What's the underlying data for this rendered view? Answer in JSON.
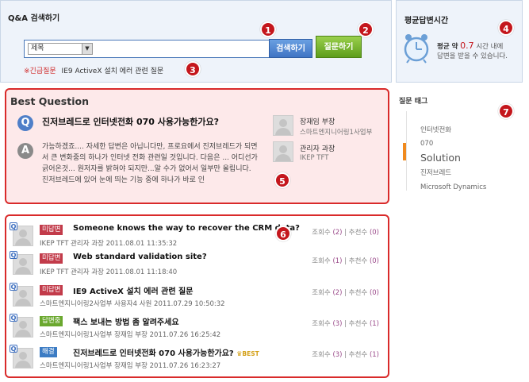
{
  "search": {
    "title": "Q&A 검색하기",
    "category": "제목",
    "search_btn": "검색하기",
    "ask_btn": "질문하기",
    "urgent_label": "긴급질문",
    "urgent_text": "IE9 ActiveX 설치 에러 관련 질문"
  },
  "avg": {
    "title": "평균답변시간",
    "prefix": "평균 약",
    "value": "0.7",
    "suffix": "시간 내에",
    "line2": "답변을 받을 수 있습니다."
  },
  "best": {
    "title": "Best Question",
    "question": "진저브레드로 인터넷전화 070 사용가능한가요?",
    "answer": "가능하겠죠.... 자세한 답변은 아닙니다만, 프로요에서 진저브레드가 되면서 큰 변화중의 하나가 인터넷 전화 관련일 것입니다. 다음은 ... 어디선가 긁어온것... 원저자를 밝혀야 되지만...알 수가 없어서 일부만 올립니다. 진저브레드에 있어 눈에 띄는 기능 중에 하나가 바로 인",
    "asker_name": "장재임 부장",
    "asker_org": "스마트엔지니어링1사업부",
    "answerer_name": "관리자 과장",
    "answerer_org": "IKEP TFT"
  },
  "tags": {
    "title": "질문 태그",
    "items": [
      "인터넷전화",
      "070",
      "Solution",
      "진저브레드",
      "Microsoft Dynamics"
    ]
  },
  "badges": [
    "1",
    "2",
    "3",
    "4",
    "5",
    "6",
    "7"
  ],
  "list": [
    {
      "status": "미답변",
      "status_color": "#c23b4a",
      "title": "Someone knows the way to recover the CRM data?",
      "meta": "IKEP TFT 관리자  과장 2011.08.01 11:35:32",
      "views": "(2)",
      "recs": "(0)",
      "best": ""
    },
    {
      "status": "미답변",
      "status_color": "#c23b4a",
      "title": "Web standard validation site?",
      "meta": "IKEP TFT 관리자  과장 2011.08.01 11:18:40",
      "views": "(1)",
      "recs": "(0)",
      "best": ""
    },
    {
      "status": "미답변",
      "status_color": "#c23b4a",
      "title": "IE9 ActiveX 설치 에러 관련 질문",
      "meta": "스마트엔지니어링2사업부 사용자4  사원 2011.07.29 10:50:32",
      "views": "(2)",
      "recs": "(0)",
      "best": ""
    },
    {
      "status": "답변중",
      "status_color": "#6aa82e",
      "title": "팩스 보내는 방법 좀 알려주세요",
      "meta": "스마트엔지니어링1사업부 장재임  부장 2011.07.26 16:25:42",
      "views": "(3)",
      "recs": "(1)",
      "best": ""
    },
    {
      "status": "해결",
      "status_color": "#3c7cc4",
      "title": "진저브레드로 인터넷전화 070 사용가능한가요?",
      "meta": "스마트엔지니어링1사업부 장재임  부장 2011.07.26 16:23:27",
      "views": "(3)",
      "recs": "(1)",
      "best": "BEST"
    }
  ],
  "labels": {
    "views": "조회수",
    "recs": "추천수",
    "q": "Q",
    "a": "A"
  }
}
